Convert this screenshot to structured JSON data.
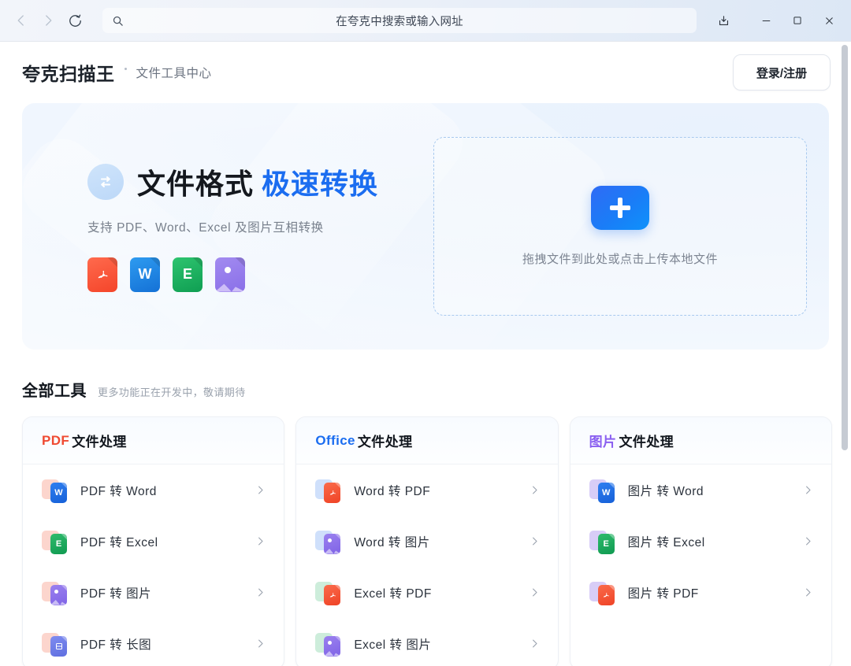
{
  "browser": {
    "back_icon": "chevron-left-icon",
    "forward_icon": "chevron-right-icon",
    "reload_icon": "reload-icon",
    "search_icon": "search-icon",
    "address_placeholder": "在夸克中搜索或输入网址",
    "address_value": "",
    "share_icon": "share-upload-icon",
    "minimize_icon": "minimize-icon",
    "maximize_icon": "maximize-icon",
    "close_icon": "close-icon"
  },
  "header": {
    "brand": "夸克扫描王",
    "subtitle": "文件工具中心",
    "login_label": "登录/注册"
  },
  "hero": {
    "swap_icon": "swap-arrows-icon",
    "title_main": "文件格式",
    "title_accent": "极速转换",
    "subtitle": "支持 PDF、Word、Excel 及图片互相转换",
    "file_icons": [
      {
        "name": "pdf-file-icon",
        "glyph": "",
        "kind": "pdf"
      },
      {
        "name": "word-file-icon",
        "glyph": "W",
        "kind": "word"
      },
      {
        "name": "excel-file-icon",
        "glyph": "E",
        "kind": "excel"
      },
      {
        "name": "image-file-icon",
        "glyph": "",
        "kind": "img"
      }
    ],
    "dropzone": {
      "plus_icon": "plus-icon",
      "text": "拖拽文件到此处或点击上传本地文件"
    }
  },
  "tools": {
    "title": "全部工具",
    "subtitle": "更多功能正在开发中，敬请期待",
    "cards": [
      {
        "keyword": "PDF",
        "keyword_color": "#ef4a32",
        "title_rest": "文件处理",
        "items": [
          {
            "label": "PDF 转 Word",
            "back": "pdf",
            "front": "word",
            "glyph": "W"
          },
          {
            "label": "PDF 转 Excel",
            "back": "pdf",
            "front": "excel",
            "glyph": "E"
          },
          {
            "label": "PDF 转 图片",
            "back": "pdf",
            "front": "img",
            "glyph": ""
          },
          {
            "label": "PDF 转 长图",
            "back": "pdf",
            "front": "long",
            "glyph": ""
          }
        ]
      },
      {
        "keyword": "Office",
        "keyword_color": "#1b6df0",
        "title_rest": "文件处理",
        "items": [
          {
            "label": "Word 转 PDF",
            "back": "word",
            "front": "pdf",
            "glyph": ""
          },
          {
            "label": "Word 转 图片",
            "back": "word",
            "front": "img",
            "glyph": ""
          },
          {
            "label": "Excel 转 PDF",
            "back": "excel",
            "front": "pdf",
            "glyph": ""
          },
          {
            "label": "Excel 转 图片",
            "back": "excel",
            "front": "img",
            "glyph": ""
          }
        ]
      },
      {
        "keyword": "图片",
        "keyword_color": "#8a5ff0",
        "title_rest": "文件处理",
        "items": [
          {
            "label": "图片 转 Word",
            "back": "img",
            "front": "word",
            "glyph": "W"
          },
          {
            "label": "图片 转 Excel",
            "back": "img",
            "front": "excel",
            "glyph": "E"
          },
          {
            "label": "图片 转 PDF",
            "back": "img",
            "front": "pdf",
            "glyph": ""
          }
        ]
      }
    ]
  },
  "scrollbar": {
    "orientation": "vertical"
  }
}
